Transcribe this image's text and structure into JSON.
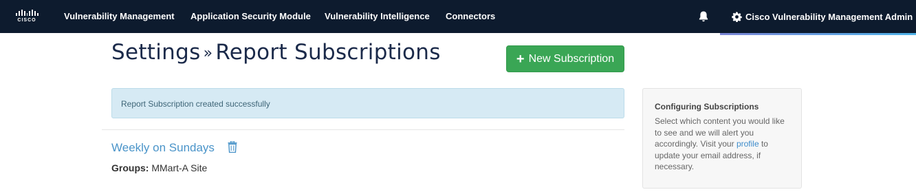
{
  "nav": {
    "logo_text": "CISCO",
    "items": [
      {
        "label": "Vulnerability Management"
      },
      {
        "label": "Application Security Module"
      },
      {
        "label": "Vulnerability Intelligence"
      },
      {
        "label": "Connectors"
      }
    ],
    "user_label": "Cisco Vulnerability Management Admin",
    "icons": [
      "cisco-logo",
      "bell-icon",
      "gear-icon",
      "caret-down-icon"
    ]
  },
  "page": {
    "title_part1": "Settings",
    "title_sep": "»",
    "title_part2": "Report Subscriptions",
    "new_button_label": "New Subscription",
    "alert_message": "Report Subscription created successfully"
  },
  "subscription": {
    "name": "Weekly on Sundays",
    "groups_label": "Groups:",
    "groups_value": "MMart-A Site"
  },
  "sidebar": {
    "heading": "Configuring Subscriptions",
    "text_before": "Select which content you would like to see and we will alert you accordingly. Visit your ",
    "link_label": "profile",
    "text_after": " to update your email address, if necessary."
  },
  "colors": {
    "navbar": "#0d1b2e",
    "primary_button": "#3aa655",
    "alert_bg": "#d6eaf4",
    "link": "#4a94c9"
  }
}
